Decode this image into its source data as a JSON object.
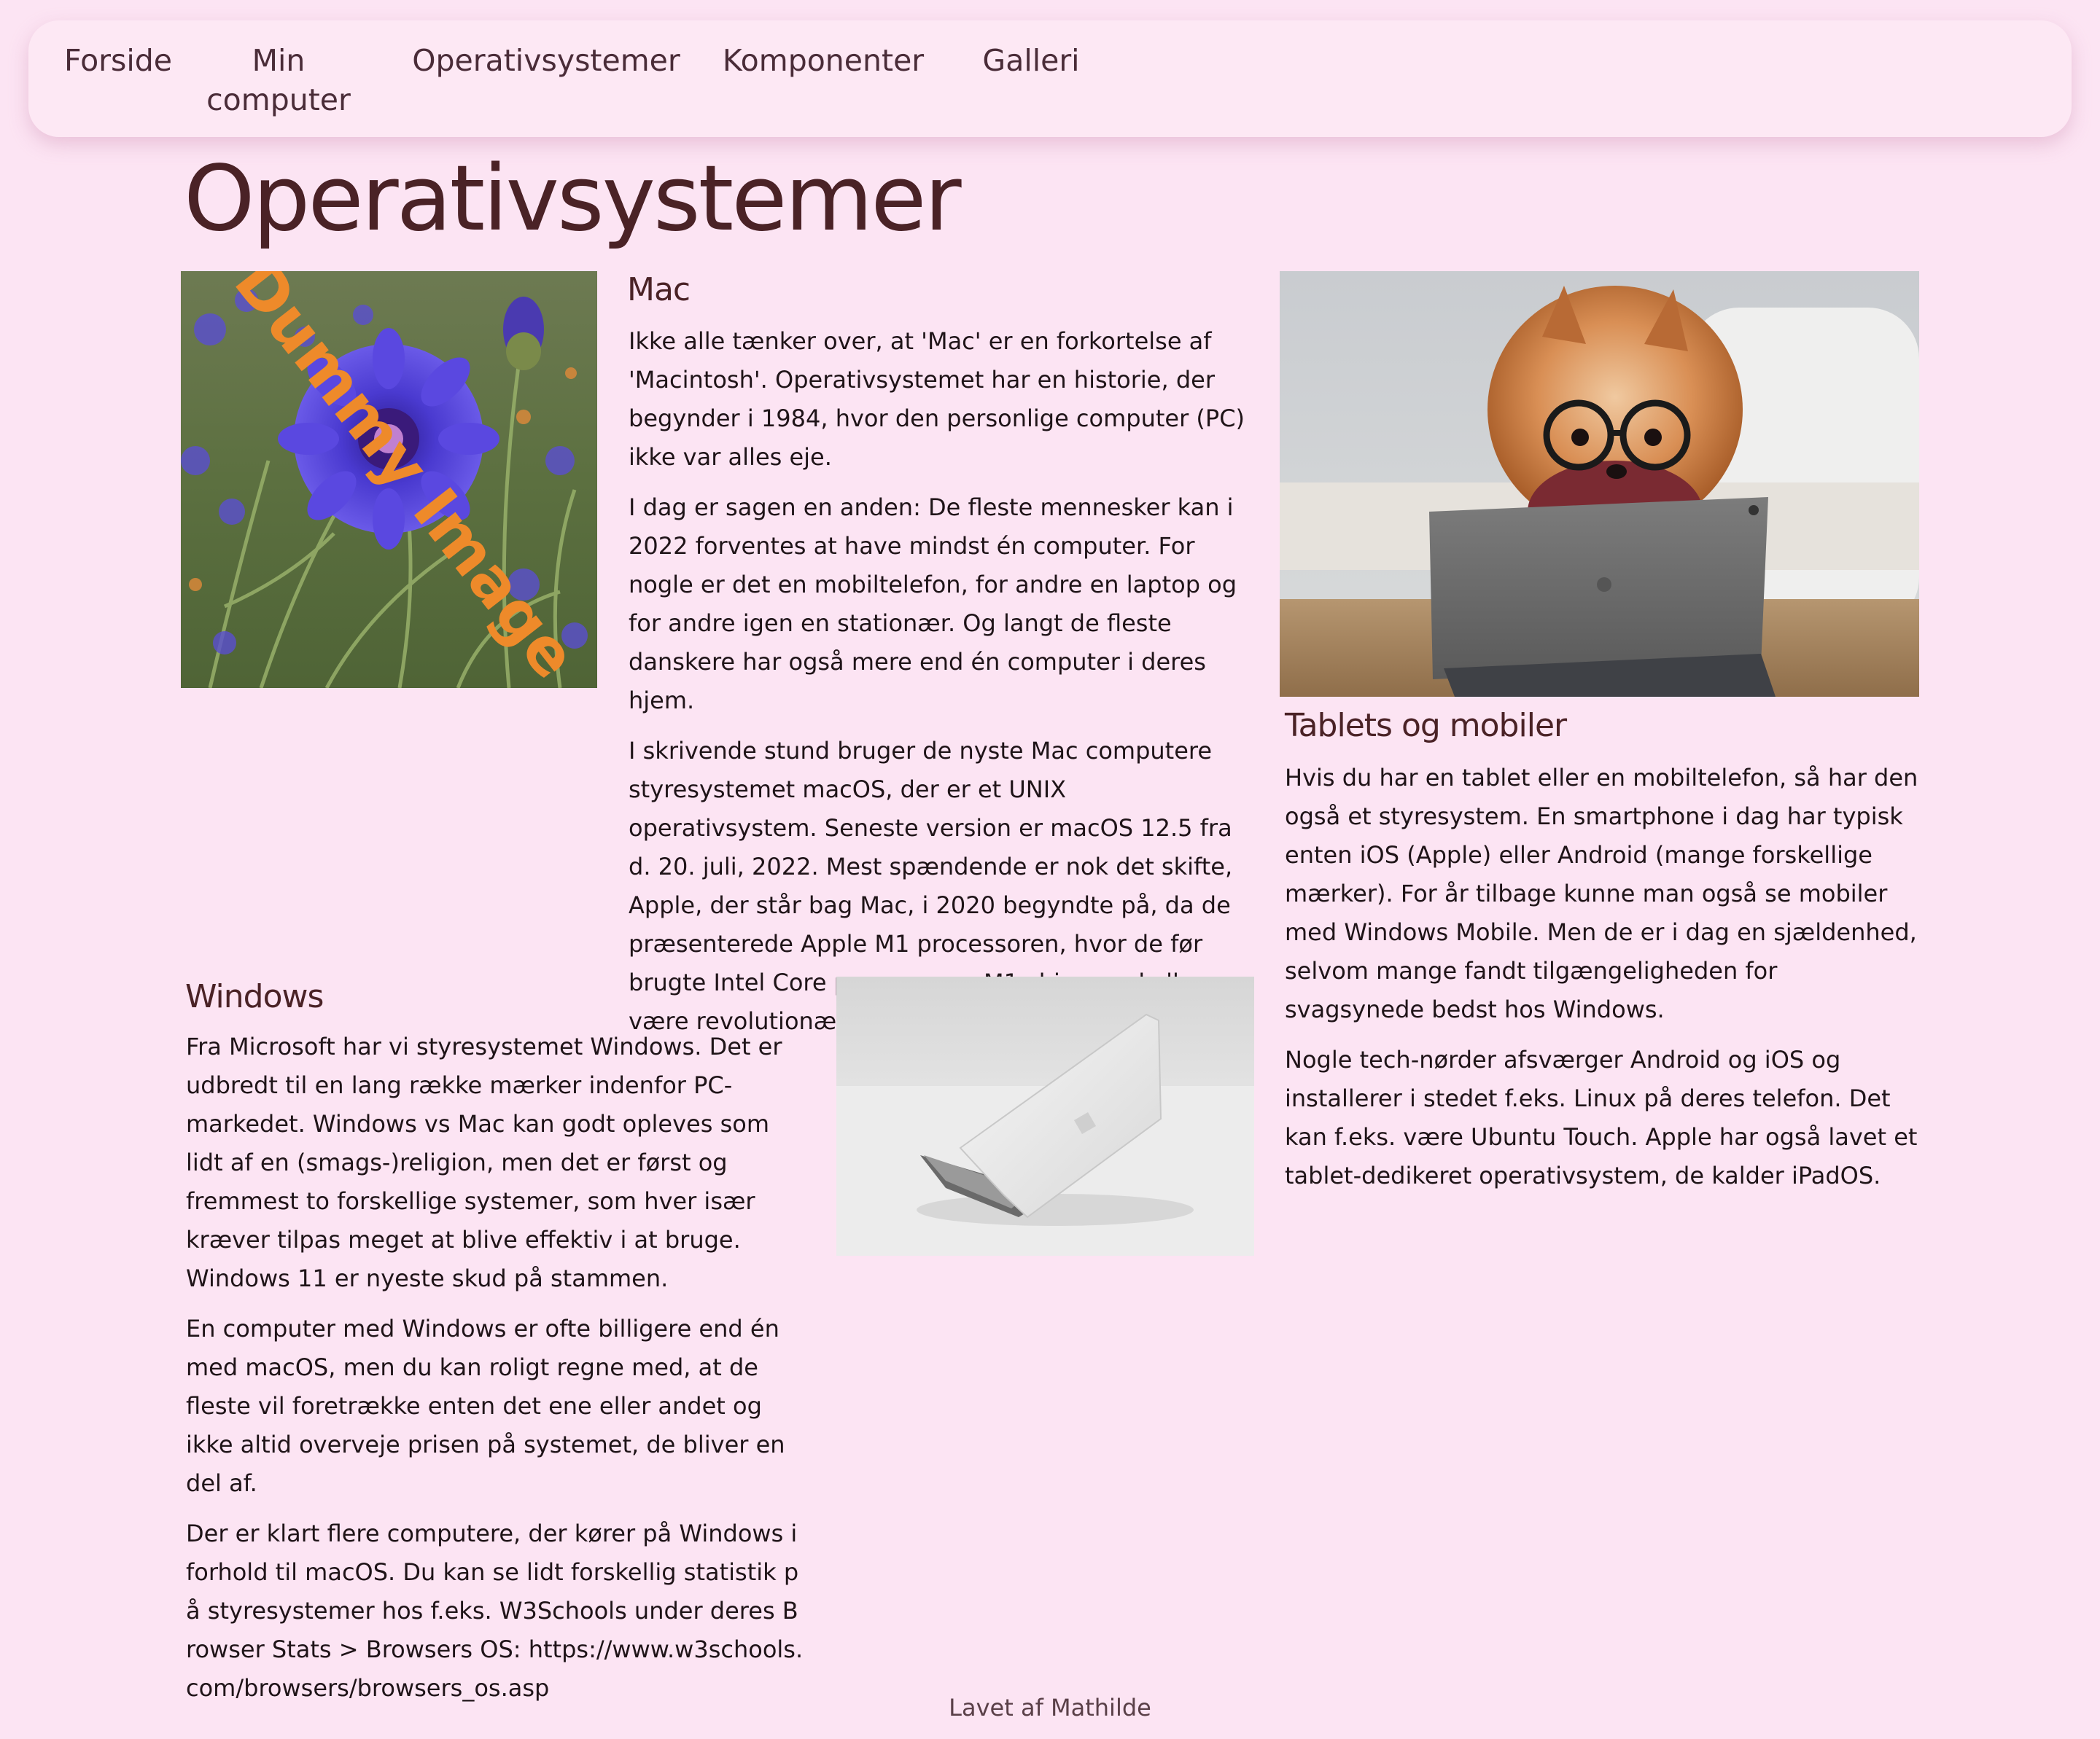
{
  "nav": {
    "items": [
      {
        "label": "Forside"
      },
      {
        "label": "Min computer"
      },
      {
        "label": "Operativsystemer"
      },
      {
        "label": "Komponenter"
      },
      {
        "label": "Galleri"
      }
    ]
  },
  "page": {
    "title": "Operativsystemer"
  },
  "mac": {
    "heading": "Mac",
    "paragraphs": [
      "Ikke alle tænker over, at 'Mac' er en forkortelse af 'Macintosh'. Operativsystemet har en historie, der begynder i 1984, hvor den personlige computer (PC) ikke var alles eje.",
      "I dag er sagen en anden: De fleste mennesker kan i 2022 forventes at have mindst én computer. For nogle er det en mobiltelefon, for andre en laptop og for andre igen en stationær. Og langt de fleste danskere har også mere end én computer i deres hjem.",
      "I skrivende stund bruger de nyste Mac computere styresystemet macOS, der er et UNIX operativsystem. Seneste version er macOS 12.5 fra d. 20. juli, 2022. Mest spændende er nok det skifte, Apple, der står bag Mac, i 2020 begyndte på, da de præsenterede Apple M1 processoren, hvor de før brugte Intel Core processorer. M1 chippen skulle være revolutionær."
    ],
    "image_watermark": "Dummy Image"
  },
  "windows": {
    "heading": "Windows",
    "paragraphs": [
      "Fra Microsoft har vi styresystemet Windows. Det er udbredt til en lang række mærker indenfor PC-markedet. Windows vs Mac kan godt opleves som lidt af en (smags-)religion, men det er først og fremmest to forskellige systemer, som hver især kræver tilpas meget at blive effektiv i at bruge. Windows 11 er nyeste skud på stammen.",
      "En computer med Windows er ofte billigere end én med macOS, men du kan roligt regne med, at de fleste vil foretrække enten det ene eller andet og ikke altid overveje prisen på systemet, de bliver en del af.",
      "Der er klart flere computere, der kører på Windows i forhold til macOS. Du kan se lidt forskellig statistik på styresystemer hos f.eks. W3Schools under deres Browser Stats > Browsers OS: https://www.w3schools.com/browsers/browsers_os.asp"
    ]
  },
  "tablets": {
    "heading": "Tablets og mobiler",
    "paragraphs": [
      "Hvis du har en tablet eller en mobiltelefon, så har den også et styresystem. En smartphone i dag har typisk enten iOS (Apple) eller Android (mange forskellige mærker). For år tilbage kunne man også se mobiler med Windows Mobile. Men de er i dag en sjældenhed, selvom mange fandt tilgængeligheden for svagsynede bedst hos Windows.",
      "Nogle tech-nørder afsværger Android og iOS og installerer i stedet f.eks. Linux på deres telefon. Det kan f.eks. være Ubuntu Touch. Apple har også lavet et tablet-dedikeret operativsystem, de kalder iPadOS."
    ]
  },
  "footer": {
    "text": "Lavet af Mathilde"
  },
  "colors": {
    "background": "#fce4f3",
    "navbar": "#fde8f4",
    "heading": "#4a2226",
    "text": "#1f1418"
  }
}
